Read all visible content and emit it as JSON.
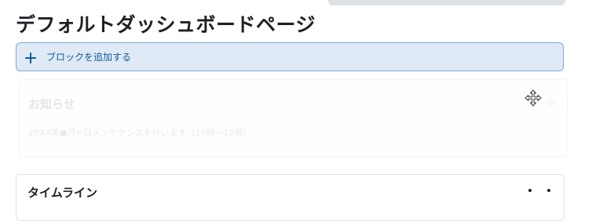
{
  "page": {
    "title": "デフォルトダッシュボードページ"
  },
  "toolbar": {
    "add_block_label": "ブロックを追加する",
    "add_block_icon": "plus-icon"
  },
  "blocks": [
    {
      "title": "お知らせ",
      "body": "20XX年●月×日メンテナンスを行います（10時〜12時）",
      "menu_icons": "⚙ ⋮",
      "state": "dragging"
    },
    {
      "title": "タイムライン",
      "menu_icon": "kebab-menu-icon"
    }
  ],
  "colors": {
    "accent": "#0f5a9c",
    "add_block_bg": "#dfeaf6",
    "add_block_border": "#7fa8d6"
  },
  "cursor_icon": "move-icon"
}
